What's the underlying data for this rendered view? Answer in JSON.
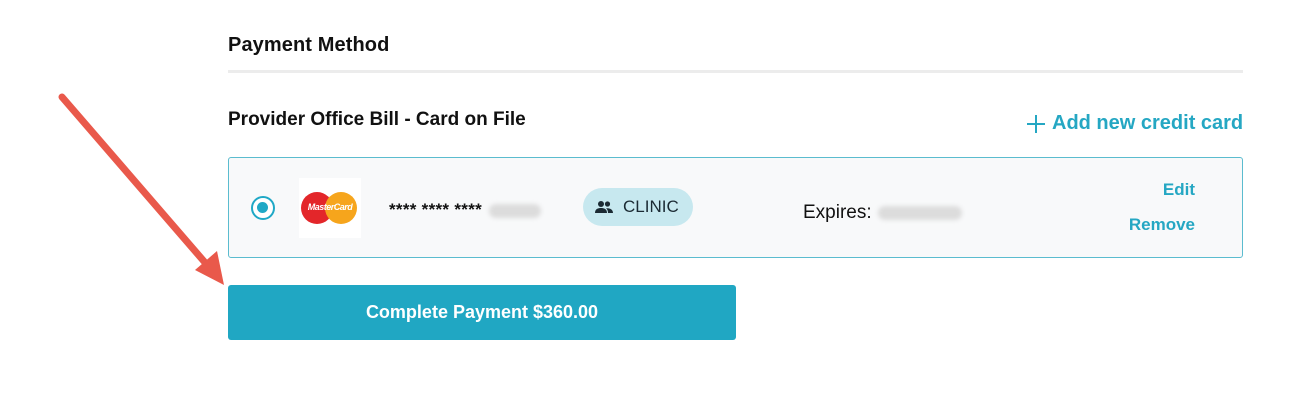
{
  "payment": {
    "title": "Payment Method",
    "subtitle": "Provider Office Bill - Card on File",
    "add_card_label": "Add new credit card"
  },
  "card": {
    "brand": "MasterCard",
    "brand_logo_text": "MasterCard",
    "masked_number": "**** **** ****",
    "badge_label": "CLINIC",
    "expires_label": "Expires:",
    "edit_label": "Edit",
    "remove_label": "Remove",
    "selected": true
  },
  "actions": {
    "complete_label": "Complete Payment $360.00"
  },
  "colors": {
    "accent": "#20a7c3",
    "badge_bg": "#c7e8ef",
    "annotation_arrow": "#e9594b",
    "card_border": "#5bbccf"
  },
  "icons": {
    "add": "plus-icon",
    "badge": "people-icon",
    "selection": "radio-selected-icon",
    "annotation": "red-arrow-icon"
  }
}
